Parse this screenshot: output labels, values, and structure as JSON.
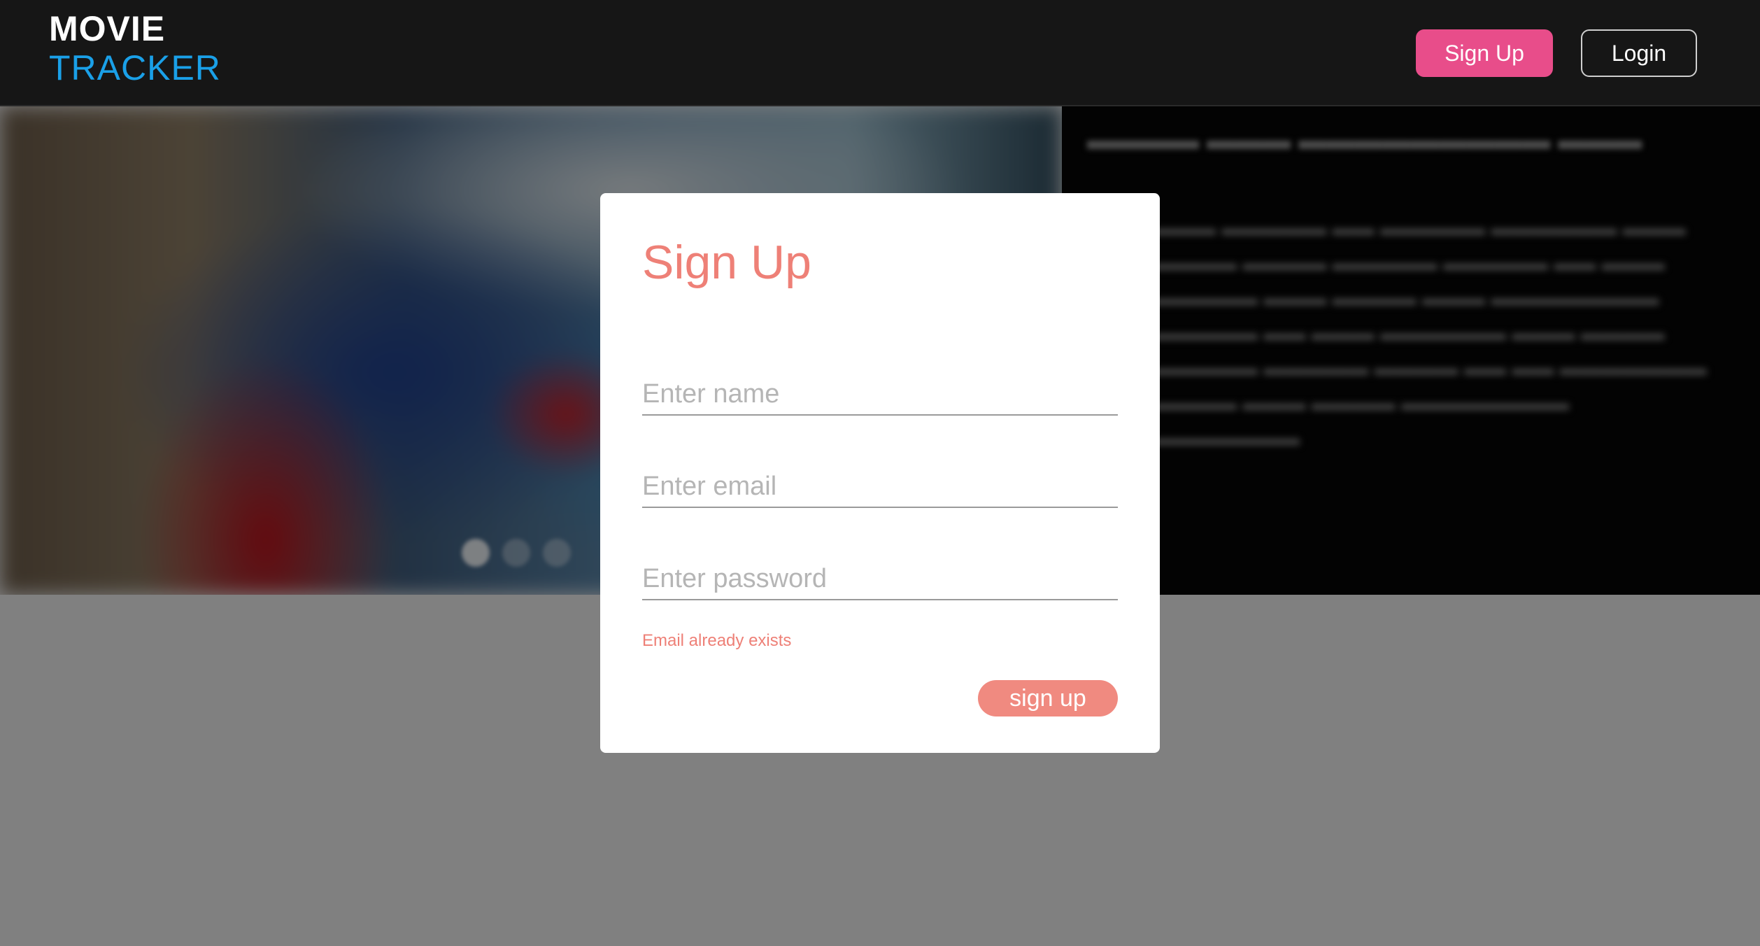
{
  "header": {
    "logo_line1": "MOVIE",
    "logo_line2": "TRACKER",
    "signup_label": "Sign Up",
    "login_label": "Login"
  },
  "modal": {
    "title": "Sign Up",
    "name_placeholder": "Enter name",
    "email_placeholder": "Enter email",
    "password_placeholder": "Enter password",
    "error": "Email already exists",
    "submit_label": "sign up"
  },
  "colors": {
    "header_bg": "#161616",
    "logo_accent": "#1aa0e8",
    "signup_button": "#e84d8a",
    "modal_accent": "#ee8077",
    "overlay": "#808080"
  }
}
